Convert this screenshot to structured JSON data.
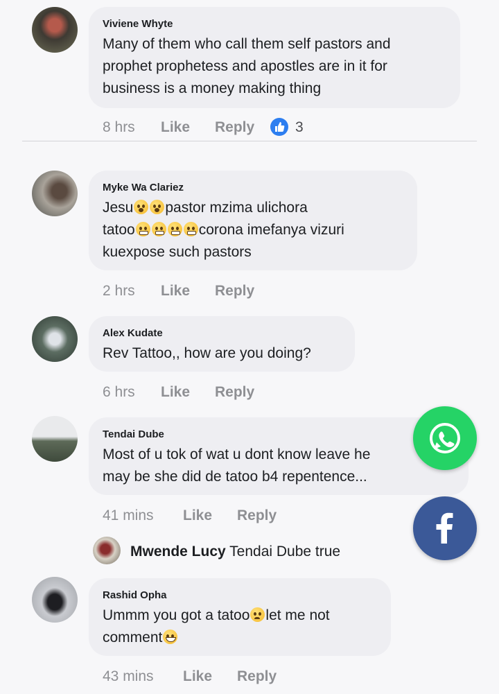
{
  "colors": {
    "whatsapp": "#25d366",
    "facebook": "#3b5998",
    "like_badge": "#2d7ef0"
  },
  "comments": [
    {
      "author": "Viviene Whyte",
      "lines": [
        "Many of them  who call them self pastors and",
        "prophet prophetess and apostles are in it for",
        "business is a money making thing"
      ],
      "time": "8 hrs",
      "like": "Like",
      "reply": "Reply",
      "reactions": "3"
    },
    {
      "author": "Myke Wa Clariez",
      "line1a": "Jesu",
      "line1b": "pastor mzima ulichora",
      "line2a": "tatoo",
      "line2b": "corona imefanya vizuri",
      "line3": "kuexpose such pastors",
      "time": "2 hrs",
      "like": "Like",
      "reply": "Reply"
    },
    {
      "author": "Alex Kudate",
      "lines": [
        "Rev Tattoo,, how are you doing?"
      ],
      "time": "6 hrs",
      "like": "Like",
      "reply": "Reply"
    },
    {
      "author": "Tendai Dube",
      "lines": [
        "Most of u tok of wat u dont know leave he",
        "may be she did de tatoo b4 repentence..."
      ],
      "time": "41 mins",
      "like": "Like",
      "reply": "Reply",
      "reply_preview": {
        "author": "Mwende Lucy",
        "text": "Tendai Dube true"
      }
    },
    {
      "author": "Rashid Opha",
      "line1a": "Ummm you got a tatoo",
      "line1b": "let me not",
      "line2a": "comment",
      "time": "43 mins",
      "like": "Like",
      "reply": "Reply"
    }
  ],
  "icons": {
    "whatsapp": "whatsapp-icon",
    "facebook": "facebook-icon",
    "like": "thumbs-up-icon"
  }
}
